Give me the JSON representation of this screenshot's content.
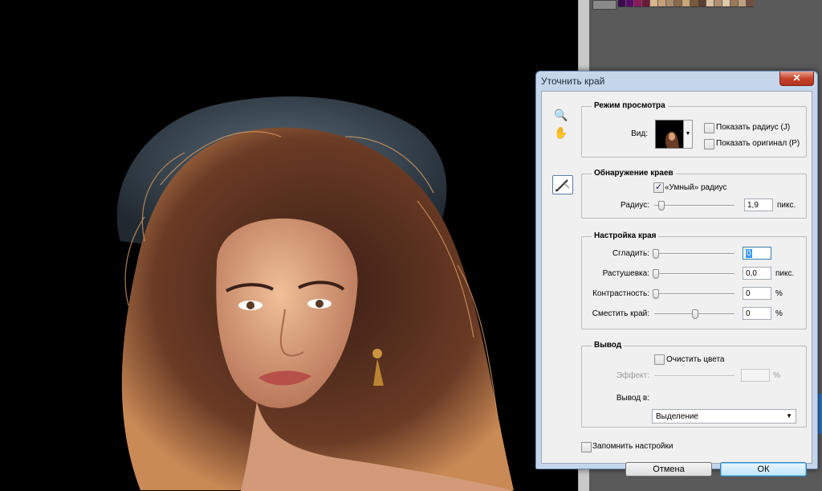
{
  "dialog": {
    "title": "Уточнить край",
    "close_glyph": "✕",
    "view_mode": {
      "title": "Режим просмотра",
      "view_label": "Вид:",
      "show_radius": "Показать радиус (J)",
      "show_original": "Показать оригинал (P)"
    },
    "edge_detection": {
      "title": "Обнаружение краев",
      "smart_radius": "«Умный» радиус",
      "radius_label": "Радиус:",
      "radius_value": "1,9",
      "radius_unit": "пикс."
    },
    "adjust_edge": {
      "title": "Настройка края",
      "smooth_label": "Сгладить:",
      "smooth_value": "0",
      "feather_label": "Растушевка:",
      "feather_value": "0,0",
      "feather_unit": "пикс.",
      "contrast_label": "Контрастность:",
      "contrast_value": "0",
      "contrast_unit": "%",
      "shift_label": "Сместить край:",
      "shift_value": "0",
      "shift_unit": "%"
    },
    "output": {
      "title": "Вывод",
      "decontaminate": "Очистить цвета",
      "amount_label": "Эффект:",
      "amount_unit": "%",
      "output_to_label": "Вывод в:",
      "output_to_value": "Выделение"
    },
    "remember": "Запомнить настройки",
    "cancel": "Отмена",
    "ok": "ОК"
  },
  "icons": {
    "zoom": "🔍",
    "hand": "✋",
    "dropdown": "▼"
  },
  "state": {
    "show_radius": false,
    "show_original": false,
    "smart_radius": true,
    "decontaminate": false,
    "remember": false,
    "radius_slider": 0.05,
    "smooth_slider": 0.0,
    "feather_slider": 0.0,
    "contrast_slider": 0.0,
    "shift_slider": 0.5
  },
  "colors": {
    "dialog_frame": "#c6d6ea",
    "dialog_body": "#f0f0f0",
    "canvas": "#000000",
    "hair": "#5a2f20",
    "skin": "#d9a07c"
  }
}
